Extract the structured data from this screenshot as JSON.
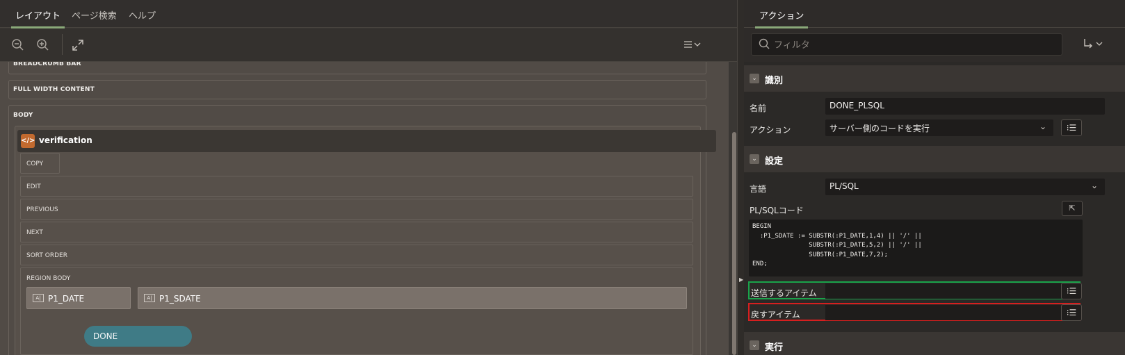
{
  "left_tabs": [
    "レイアウト",
    "ページ検索",
    "ヘルプ"
  ],
  "toolbar": {
    "zoom_out_icon": "zoom-out-icon",
    "zoom_in_icon": "zoom-in-icon",
    "expand_icon": "expand-icon",
    "menu_icon": "menu-icon"
  },
  "layout": {
    "breadcrumb_bar": "BREADCRUMB BAR",
    "full_width_content": "FULL WIDTH CONTENT",
    "body": "BODY",
    "region_title": "verification",
    "slots": [
      "COPY",
      "EDIT",
      "PREVIOUS",
      "NEXT",
      "SORT ORDER",
      "REGION BODY"
    ],
    "items": [
      "P1_DATE",
      "P1_SDATE"
    ],
    "item_badge": "A|",
    "button": "DONE"
  },
  "right": {
    "tab": "アクション",
    "filter_placeholder": "フィルタ",
    "section_identification": "識別",
    "name_label": "名前",
    "name_value": "DONE_PLSQL",
    "action_label": "アクション",
    "action_value": "サーバー側のコードを実行",
    "section_settings": "設定",
    "language_label": "言語",
    "language_value": "PL/SQL",
    "plsql_label": "PL/SQLコード",
    "code": "BEGIN\n  :P1_SDATE := SUBSTR(:P1_DATE,1,4) || '/' ||\n               SUBSTR(:P1_DATE,5,2) || '/' ||\n               SUBSTR(:P1_DATE,7,2);\nEND;",
    "items_to_submit_label": "送信するアイテム",
    "items_to_return_label": "戻すアイテム",
    "section_execution": "実行"
  },
  "colors": {
    "accent_tab": "#8aa979",
    "submit_highlight": "#1aa34a",
    "return_highlight": "#d61f1f",
    "done_button": "#3f7b86",
    "region_icon": "#c26a2f"
  }
}
